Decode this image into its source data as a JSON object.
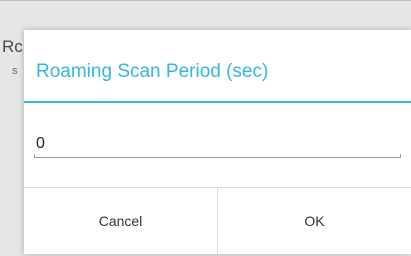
{
  "background": {
    "title": "Rc",
    "subtitle": "s"
  },
  "dialog": {
    "title": "Roaming Scan Period (sec)",
    "input_value": "0",
    "cancel_label": "Cancel",
    "ok_label": "OK",
    "accent_color": "#33b5e5"
  }
}
